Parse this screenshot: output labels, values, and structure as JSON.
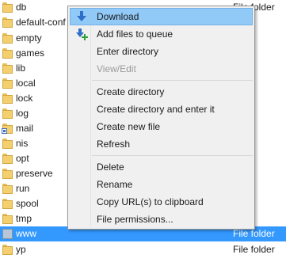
{
  "file_list": {
    "rows": [
      {
        "name": "db",
        "type": "File folder",
        "icon": "folder-icon"
      },
      {
        "name": "default-conf",
        "type": "",
        "icon": "folder-icon"
      },
      {
        "name": "empty",
        "type": "",
        "icon": "folder-icon"
      },
      {
        "name": "games",
        "type": "",
        "icon": "folder-icon"
      },
      {
        "name": "lib",
        "type": "",
        "icon": "folder-icon"
      },
      {
        "name": "local",
        "type": "",
        "icon": "folder-icon"
      },
      {
        "name": "lock",
        "type": "",
        "icon": "folder-icon"
      },
      {
        "name": "log",
        "type": "",
        "icon": "folder-icon"
      },
      {
        "name": "mail",
        "type": "",
        "icon": "folder-link-icon"
      },
      {
        "name": "nis",
        "type": "",
        "icon": "folder-icon"
      },
      {
        "name": "opt",
        "type": "",
        "icon": "folder-icon"
      },
      {
        "name": "preserve",
        "type": "",
        "icon": "folder-icon"
      },
      {
        "name": "run",
        "type": "",
        "icon": "folder-icon"
      },
      {
        "name": "spool",
        "type": "",
        "icon": "folder-icon"
      },
      {
        "name": "tmp",
        "type": "",
        "icon": "folder-icon"
      },
      {
        "name": "www",
        "type": "File folder",
        "icon": "selected-folder-icon"
      },
      {
        "name": "yp",
        "type": "File folder",
        "icon": "folder-icon"
      }
    ],
    "selected_row_color": "#3399ff"
  },
  "context_menu": {
    "items": [
      {
        "label": "Download",
        "icon": "download-arrow-icon"
      },
      {
        "label": "Add files to queue",
        "icon": "add-to-queue-icon"
      },
      {
        "label": "Enter directory"
      },
      {
        "label": "View/Edit"
      },
      {
        "label": "Create directory"
      },
      {
        "label": "Create directory and enter it"
      },
      {
        "label": "Create new file"
      },
      {
        "label": "Refresh"
      },
      {
        "label": "Delete"
      },
      {
        "label": "Rename"
      },
      {
        "label": "Copy URL(s) to clipboard"
      },
      {
        "label": "File permissions..."
      }
    ],
    "highlight_color": "#91c9f7",
    "disabled_color": "#9a9a9a"
  }
}
